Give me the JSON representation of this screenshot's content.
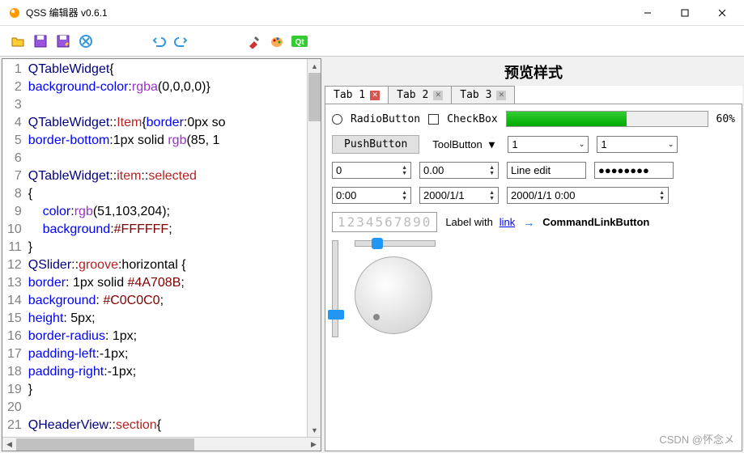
{
  "window": {
    "title": "QSS 编辑器 v0.6.1"
  },
  "code": {
    "lines": [
      {
        "n": 1,
        "h": "<span class='sel'>QTableWidget</span>{"
      },
      {
        "n": 2,
        "h": "<span class='prop'>background-color</span>:<span class='kw'>rgba</span>(0,0,0,0)}"
      },
      {
        "n": 3,
        "h": ""
      },
      {
        "n": 4,
        "h": "<span class='sel'>QTableWidget</span>::<span class='pseudo'>Item</span>{<span class='prop'>border</span>:0px so"
      },
      {
        "n": 5,
        "h": "<span class='prop'>border-bottom</span>:1px solid <span class='kw'>rgb</span>(85, 1"
      },
      {
        "n": 6,
        "h": ""
      },
      {
        "n": 7,
        "h": "<span class='sel'>QTableWidget</span>::<span class='pseudo'>item</span>::<span class='pseudo'>selected</span>"
      },
      {
        "n": 8,
        "h": "{"
      },
      {
        "n": 9,
        "h": "    <span class='prop'>color</span>:<span class='kw'>rgb</span>(51,103,204);"
      },
      {
        "n": 10,
        "h": "    <span class='prop'>background</span>:<span class='val'>#FFFFFF</span>;"
      },
      {
        "n": 11,
        "h": "}"
      },
      {
        "n": 12,
        "h": "<span class='sel'>QSlider</span>::<span class='pseudo'>groove</span>:horizontal {"
      },
      {
        "n": 13,
        "h": "<span class='prop'>border</span>: 1px solid <span class='val'>#4A708B</span>;"
      },
      {
        "n": 14,
        "h": "<span class='prop'>background</span>: <span class='val'>#C0C0C0</span>;"
      },
      {
        "n": 15,
        "h": "<span class='prop'>height</span>: 5px;"
      },
      {
        "n": 16,
        "h": "<span class='prop'>border-radius</span>: 1px;"
      },
      {
        "n": 17,
        "h": "<span class='prop'>padding-left</span>:-1px;"
      },
      {
        "n": 18,
        "h": "<span class='prop'>padding-right</span>:-1px;"
      },
      {
        "n": 19,
        "h": "}"
      },
      {
        "n": 20,
        "h": ""
      },
      {
        "n": 21,
        "h": "<span class='sel'>QHeaderView</span>::<span class='pseudo'>section</span>{"
      }
    ]
  },
  "preview": {
    "title": "预览样式",
    "tabs": [
      {
        "label": "Tab 1",
        "active": true,
        "close": "x"
      },
      {
        "label": "Tab 2",
        "active": false,
        "close": "g"
      },
      {
        "label": "Tab 3",
        "active": false,
        "close": "g"
      }
    ],
    "radio": "RadioButton",
    "checkbox": "CheckBox",
    "progress_pct": "60%",
    "pushbutton": "PushButton",
    "toolbutton": "ToolButton",
    "combo1": "1",
    "combo2": "1",
    "spin_int": "0",
    "spin_dbl": "0.00",
    "line_edit": "Line edit",
    "password": "●●●●●●●●",
    "time": "0:00",
    "date": "2000/1/1",
    "datetime": "2000/1/1 0:00",
    "lcd": "1234567890",
    "label": "Label with",
    "link": "link",
    "cmdlink": "CommandLinkButton"
  },
  "watermark": "CSDN @怀念メ"
}
